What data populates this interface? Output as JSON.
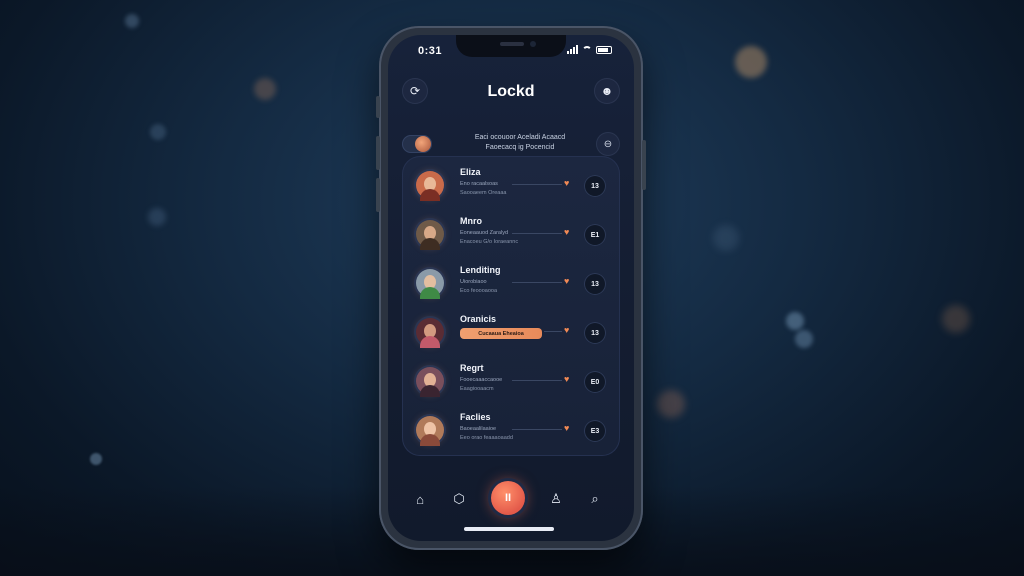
{
  "status": {
    "time": "0:31"
  },
  "app": {
    "title": "Lockd"
  },
  "header": {
    "left_icon": "refresh-icon",
    "right_icon": "profile-icon"
  },
  "toggle_row": {
    "text_line1": "Eaci ocouoor Aceladi Acaacd",
    "text_line2": "Faoecacq ig Pocencid",
    "right_icon": "lock-icon"
  },
  "contacts": [
    {
      "name": "Eliza",
      "sub1": "Eno racaalsoas",
      "sub2": "Saooaeem Oreaaa",
      "count": "13"
    },
    {
      "name": "Mnro",
      "sub1": "Eoneaauod Zaralyd",
      "sub2": "Enacoeu G/o Ioraeannc",
      "count": "E1"
    },
    {
      "name": "Lenditing",
      "sub1": "Uiorobiaoo",
      "sub2": "Eco feoooaooa",
      "count": "13"
    },
    {
      "name": "Oranicis",
      "pill": "Cucaaua Eheaioa",
      "count": "13"
    },
    {
      "name": "Regrt",
      "sub1": "Fooecaaaccaooe",
      "sub2": "Eaagiooaacm",
      "count": "E0"
    },
    {
      "name": "Faclies",
      "sub1": "Baoeaalilaaioe",
      "sub2": "Eeo orao feaaaoaadd",
      "count": "E3"
    }
  ],
  "tabbar": {
    "items": [
      "home-icon",
      "circle-icon",
      "pause-icon",
      "user-icon",
      "search-icon"
    ],
    "fab_label": "II"
  },
  "colors": {
    "accent": "#f28a55",
    "background": "#142a42",
    "screen": "#17223a"
  }
}
